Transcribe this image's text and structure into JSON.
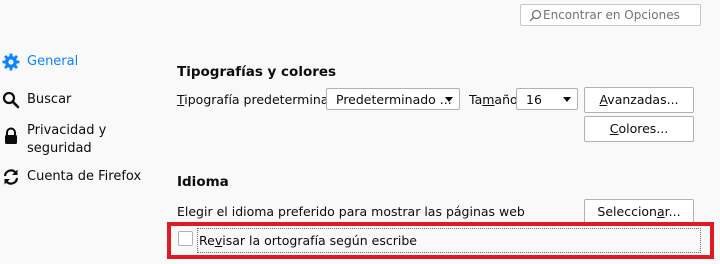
{
  "search": {
    "placeholder": "Encontrar en Opciones",
    "icon": "search-icon"
  },
  "sidebar": {
    "items": [
      {
        "label": "General",
        "icon": "gear-icon",
        "selected": true
      },
      {
        "label": "Buscar",
        "icon": "search-icon",
        "selected": false
      },
      {
        "label_line1": "Privacidad y",
        "label_line2": "seguridad",
        "icon": "lock-icon",
        "selected": false
      },
      {
        "label": "Cuenta de Firefox",
        "icon": "sync-icon",
        "selected": false
      }
    ]
  },
  "fonts": {
    "title": "Tipografías y colores",
    "default_font_label_first": "T",
    "default_font_label_rest": "ipografía predeterminada",
    "default_font_value": "Predeterminado ...",
    "size_label_before": "Ta",
    "size_label_underlined": "m",
    "size_label_after": "año",
    "size_value": "16",
    "advanced_before": "",
    "advanced_underlined": "A",
    "advanced_after": "vanzadas...",
    "colors_before": "",
    "colors_underlined": "C",
    "colors_after": "olores..."
  },
  "language": {
    "title": "Idioma",
    "choose_label": "Elegir el idioma preferido para mostrar las páginas web",
    "select_before": "Seleccion",
    "select_underlined": "a",
    "select_after": "r...",
    "spellcheck_before": "Re",
    "spellcheck_underlined": "v",
    "spellcheck_after": "isar la ortografía según escribe",
    "spellcheck_checked": false
  },
  "colors": {
    "accent": "#0a84ff",
    "highlight": "#e01a22",
    "background": "#f9f9fa"
  }
}
